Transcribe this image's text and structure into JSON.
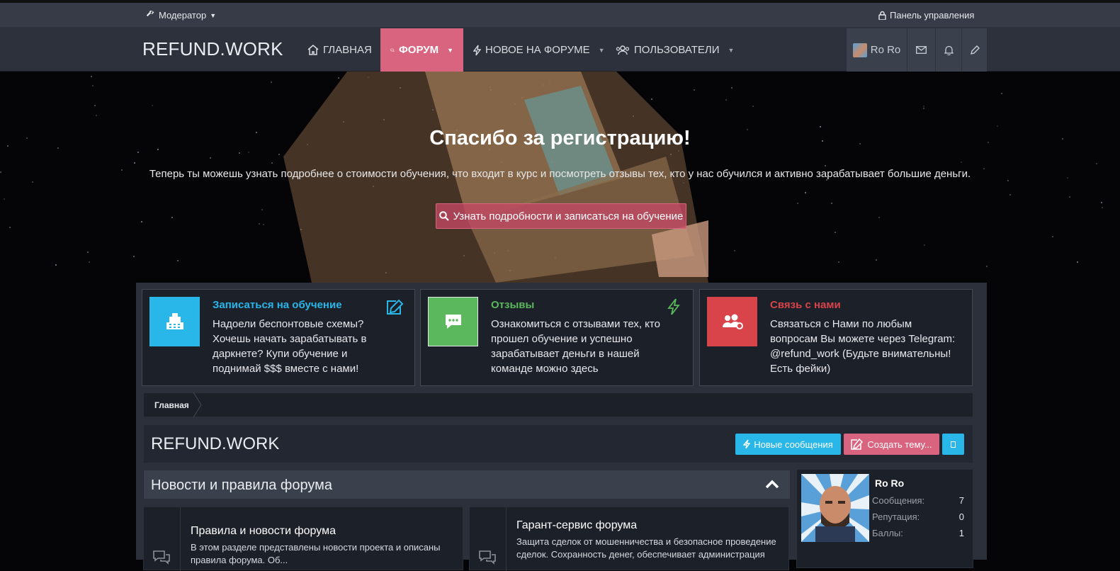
{
  "topbar": {
    "moderator_label": "Модератор",
    "control_panel_label": "Панель управления"
  },
  "nav": {
    "logo": "REFUND.WORK",
    "items": [
      {
        "label": "ГЛАВНАЯ",
        "icon": "home-icon"
      },
      {
        "label": "ФОРУМ",
        "icon": "comments-icon",
        "active": true
      },
      {
        "label": "НОВОЕ НА ФОРУМЕ",
        "icon": "bolt-icon"
      },
      {
        "label": "ПОЛЬЗОВАТЕЛИ",
        "icon": "users-icon"
      }
    ],
    "user_name": "Ro Ro"
  },
  "hero": {
    "title": "Спасибо за регистрацию!",
    "subtitle": "Теперь ты можешь узнать подробнее о стоимости обучения, что входит в курс и посмотреть отзывы тех, кто у нас обучился и активно зарабатывает большие деньги.",
    "button_label": "Узнать подробности и записаться на обучение"
  },
  "cards": [
    {
      "title": "Записаться на обучение",
      "text": "Надоели беспонтовые схемы? Хочешь начать зарабатывать в даркнете? Купи обучение и поднимай $$$ вместе с нами!",
      "color": "#29b6e8",
      "icon": "cash-register-icon"
    },
    {
      "title": "Отзывы",
      "text": "Ознакомиться с отзывами тех, кто прошел обучение и успешно зарабатывает деньги в нашей команде можно здесь",
      "color": "#5cb85c",
      "icon": "comment-dots-icon"
    },
    {
      "title": "Связь с нами",
      "text": "Связаться с Нами по любым вопросам Вы можете через Telegram: @refund_work (Будьте внимательны! Есть фейки)",
      "color": "#d9444a",
      "icon": "users-cog-icon"
    }
  ],
  "breadcrumb": {
    "home": "Главная"
  },
  "title_bar": {
    "page_title": "REFUND.WORK",
    "new_posts_label": "Новые сообщения",
    "create_topic_label": "Создать тему..."
  },
  "forum_block": {
    "title": "Новости и правила форума",
    "nodes": [
      {
        "title": "Правила и новости форума",
        "desc": "В этом разделе представлены новости проекта и описаны правила форума. Об..."
      },
      {
        "title": "Гарант-сервис форума",
        "desc": "Защита сделок от мошенничества и безопасное проведение сделок. Сохранность денег, обеспечивает администрация"
      }
    ]
  },
  "profile": {
    "name": "Ro Ro",
    "stats": [
      {
        "label": "Сообщения:",
        "value": "7"
      },
      {
        "label": "Репутация:",
        "value": "0"
      },
      {
        "label": "Баллы:",
        "value": "1"
      }
    ]
  },
  "colors": {
    "accent_pink": "#d9647f",
    "accent_blue": "#29b6e8",
    "accent_green": "#5cb85c",
    "accent_red": "#d9444a"
  }
}
